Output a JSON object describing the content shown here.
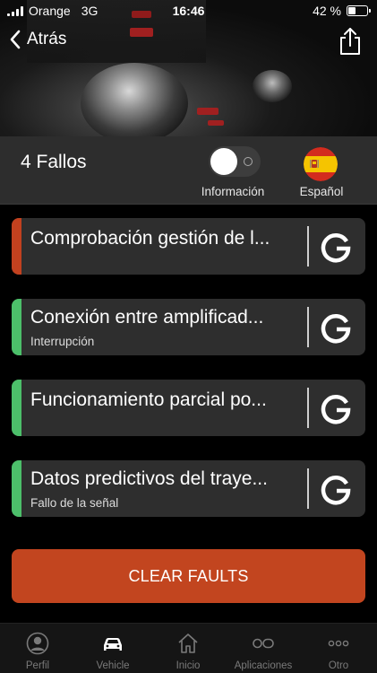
{
  "status_bar": {
    "carrier": "Orange",
    "network": "3G",
    "time": "16:46",
    "battery": "42 %",
    "battery_level": 0.42
  },
  "nav": {
    "back_label": "Atrás",
    "back_icon": "chevron-left-icon",
    "share_icon": "share-icon"
  },
  "summary": {
    "fault_count": "4 Fallos",
    "toggle_label": "Información",
    "toggle_on": false,
    "language_label": "Español",
    "language_flag": "spain-flag-icon"
  },
  "faults": [
    {
      "title": "Comprobación gestión de l...",
      "subtitle": "",
      "status_color": "#c2411f"
    },
    {
      "title": "Conexión entre amplificad...",
      "subtitle": "Interrupción",
      "status_color": "#4cbf6a"
    },
    {
      "title": "Funcionamiento parcial po...",
      "subtitle": "",
      "status_color": "#4cbf6a"
    },
    {
      "title": "Datos predictivos del traye...",
      "subtitle": "Fallo de la señal",
      "status_color": "#4cbf6a"
    }
  ],
  "actions": {
    "clear_label": "CLEAR FAULTS",
    "clear_color": "#c2451f"
  },
  "tabs": [
    {
      "label": "Perfil",
      "icon": "profile-icon",
      "active": false
    },
    {
      "label": "Vehicle",
      "icon": "car-icon",
      "active": true
    },
    {
      "label": "Inicio",
      "icon": "home-icon",
      "active": false
    },
    {
      "label": "Aplicaciones",
      "icon": "apps-icon",
      "active": false
    },
    {
      "label": "Otro",
      "icon": "more-icon",
      "active": false
    }
  ]
}
